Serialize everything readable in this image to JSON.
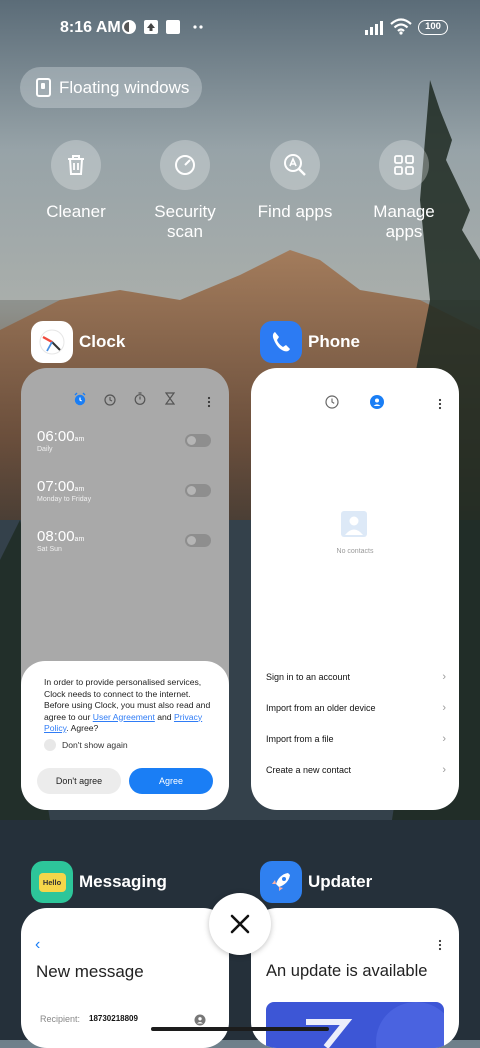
{
  "status_bar": {
    "time": "8:16 AM",
    "battery": "100",
    "icons": [
      "app-notification-icon",
      "upload-icon",
      "square-icon",
      "more-dots-icon",
      "signal-icon",
      "wifi-icon",
      "battery-icon"
    ]
  },
  "floating_windows": {
    "label": "Floating windows"
  },
  "quick_actions": [
    {
      "label": "Cleaner",
      "icon": "trash-icon"
    },
    {
      "label": "Security scan",
      "icon": "security-icon"
    },
    {
      "label": "Find apps",
      "icon": "find-apps-icon"
    },
    {
      "label": "Manage apps",
      "icon": "grid-icon"
    }
  ],
  "clock_app": {
    "name": "Clock",
    "alarms": [
      {
        "time": "06:00",
        "ampm": "am",
        "sub": "Daily"
      },
      {
        "time": "07:00",
        "ampm": "am",
        "sub": "Monday to Friday"
      },
      {
        "time": "08:00",
        "ampm": "am",
        "sub": "Sat Sun"
      }
    ],
    "dialog": {
      "text_before": "In order to provide personalised services, Clock needs to connect to the internet. Before using Clock, you must also read and agree to our ",
      "link1": "User Agreement",
      "text_mid": " and ",
      "link2": "Privacy Policy",
      "text_after": ". Agree?",
      "checkbox_label": "Don't show again",
      "disagree": "Don't agree",
      "agree": "Agree"
    }
  },
  "phone_app": {
    "name": "Phone",
    "empty_label": "No contacts",
    "actions": [
      "Sign in to an account",
      "Import from an older device",
      "Import from a file",
      "Create a new contact"
    ]
  },
  "messaging_app": {
    "name": "Messaging",
    "icon_text": "Hello",
    "title": "New message",
    "recipient_label": "Recipient:",
    "recipient_value": "18730218809"
  },
  "updater_app": {
    "name": "Updater",
    "title": "An update is available"
  },
  "colors": {
    "accent_blue": "#1a7ef5",
    "clock_icon_bg": "#ffffff",
    "phone_icon_bg": "#2c7bf3",
    "messaging_icon_bg": "#2dc69a",
    "updater_icon_bg": "#2f80f0"
  }
}
